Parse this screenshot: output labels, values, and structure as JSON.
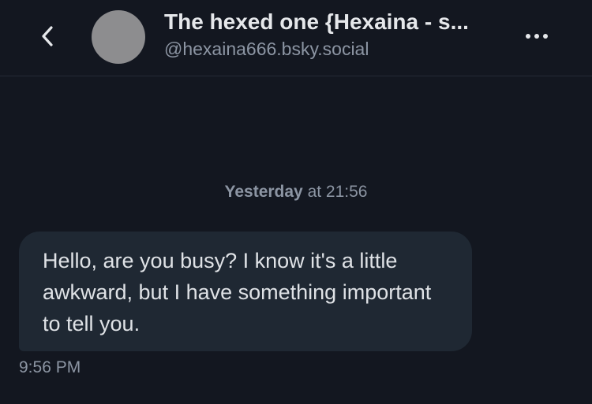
{
  "header": {
    "back_icon": "chevron-left-icon",
    "title": "The hexed one {Hexaina - s...",
    "handle": "@hexaina666.bsky.social",
    "more_icon": "more-horizontal-icon"
  },
  "conversation": {
    "date_day": "Yesterday",
    "date_rest": " at 21:56",
    "messages": [
      {
        "text": "Hello, are you busy? I know it's a little awkward, but I have something important to tell you.",
        "time": "9:56 PM"
      }
    ]
  },
  "colors": {
    "background": "#131720",
    "bubble": "#1f2833",
    "primary_text": "#e6e8eb",
    "muted_text": "#8c95a3",
    "avatar_placeholder": "#8d8d8f"
  }
}
